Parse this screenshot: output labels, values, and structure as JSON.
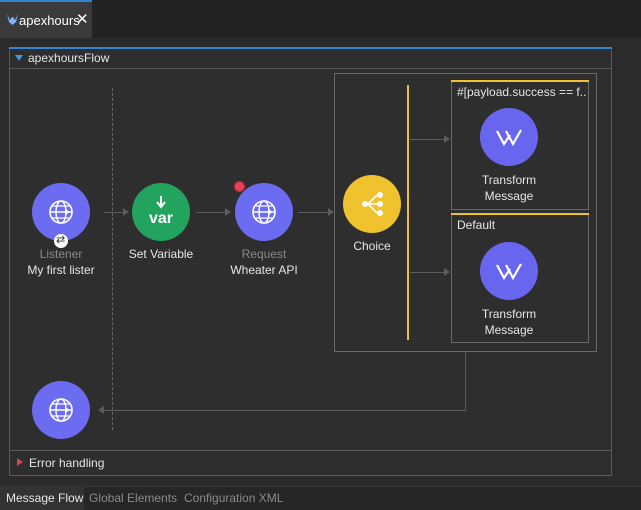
{
  "editor_tab": {
    "label": "apexhours",
    "close_label": "✕"
  },
  "flow": {
    "name": "apexhoursFlow"
  },
  "components": {
    "listener": {
      "type_label": "Listener",
      "name": "My first lister"
    },
    "set_variable": {
      "icon_text": "var",
      "name": "Set Variable"
    },
    "request": {
      "type_label": "Request",
      "name": "Wheater API"
    },
    "choice": {
      "name": "Choice"
    },
    "route_when": {
      "expression": "#[payload.success == f...",
      "component_line1": "Transform",
      "component_line2": "Message"
    },
    "route_default": {
      "label": "Default",
      "component_line1": "Transform",
      "component_line2": "Message"
    }
  },
  "error_handling": {
    "label": "Error handling"
  },
  "bottom_tabs": [
    "Message Flow",
    "Global Elements",
    "Configuration XML"
  ],
  "colors": {
    "accent": "#2f86d6",
    "http_node": "#6b6cf1",
    "set_variable_node": "#22a35e",
    "choice_node": "#f0c22d",
    "error_marker": "#ea3f56"
  }
}
